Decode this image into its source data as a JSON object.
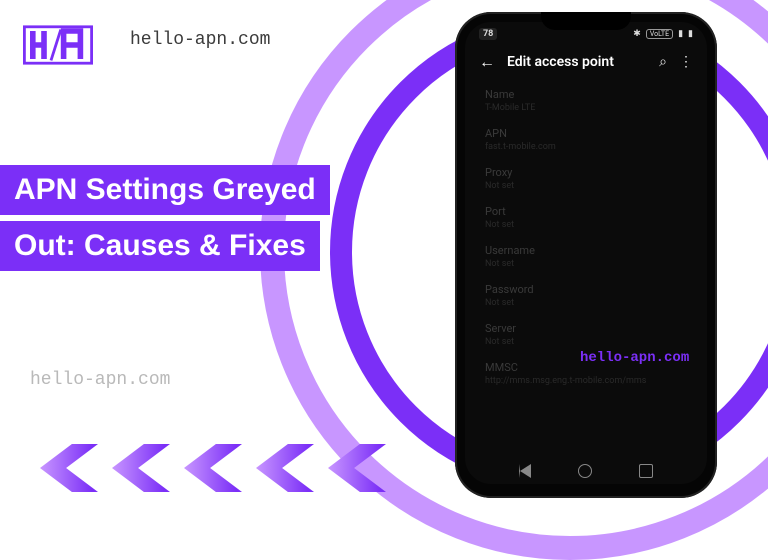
{
  "watermarks": {
    "top": "hello-apn.com",
    "left": "hello-apn.com",
    "phone": "hello-apn.com"
  },
  "headline": {
    "line1": "APN Settings Greyed",
    "line2": "Out: Causes & Fixes"
  },
  "phone": {
    "status": {
      "left": "78",
      "volte": "VoLTE"
    },
    "appbar": {
      "title": "Edit access point"
    },
    "fields": [
      {
        "label": "Name",
        "value": "T-Mobile LTE"
      },
      {
        "label": "APN",
        "value": "fast.t-mobile.com"
      },
      {
        "label": "Proxy",
        "value": "Not set"
      },
      {
        "label": "Port",
        "value": "Not set"
      },
      {
        "label": "Username",
        "value": "Not set"
      },
      {
        "label": "Password",
        "value": "Not set"
      },
      {
        "label": "Server",
        "value": "Not set"
      },
      {
        "label": "MMSC",
        "value": "http://mms.msg.eng.t-mobile.com/mms"
      }
    ]
  }
}
